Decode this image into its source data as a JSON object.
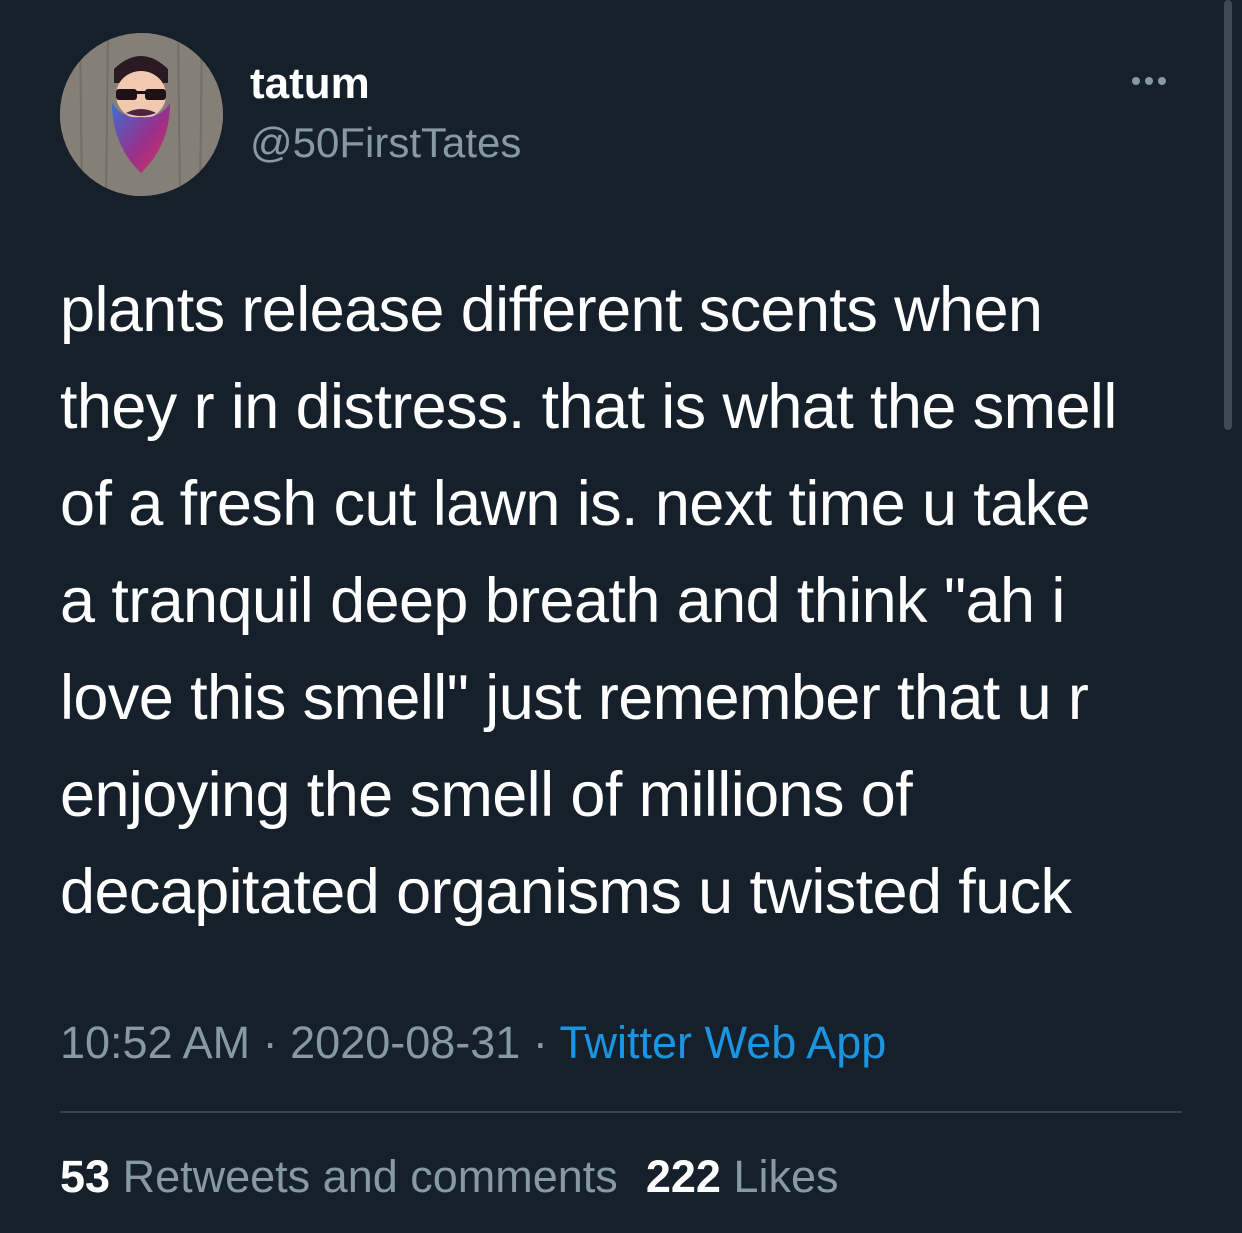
{
  "author": {
    "display_name": "tatum",
    "handle": "@50FirstTates",
    "avatar_icon": "bearded-man-with-sunglasses-avatar"
  },
  "more_icon": "more-horizontal-icon",
  "tweet": {
    "text": "plants release different scents when\nthey r in distress. that is what the smell\nof a fresh cut lawn is. next time u take\na tranquil deep breath and think \"ah i\nlove this smell\" just remember that u r\nenjoying the smell of millions of\ndecapitated organisms u twisted fuck"
  },
  "meta": {
    "time": "10:52 AM",
    "separator": " · ",
    "date": "2020-08-31",
    "source": "Twitter Web App"
  },
  "stats": {
    "retweets_count": "53",
    "retweets_label": "Retweets and comments",
    "likes_count": "222",
    "likes_label": "Likes"
  },
  "colors": {
    "background": "#15202b",
    "primary_text": "#ffffff",
    "secondary_text": "#8899a6",
    "link": "#1b95e0",
    "divider": "#38444d"
  }
}
